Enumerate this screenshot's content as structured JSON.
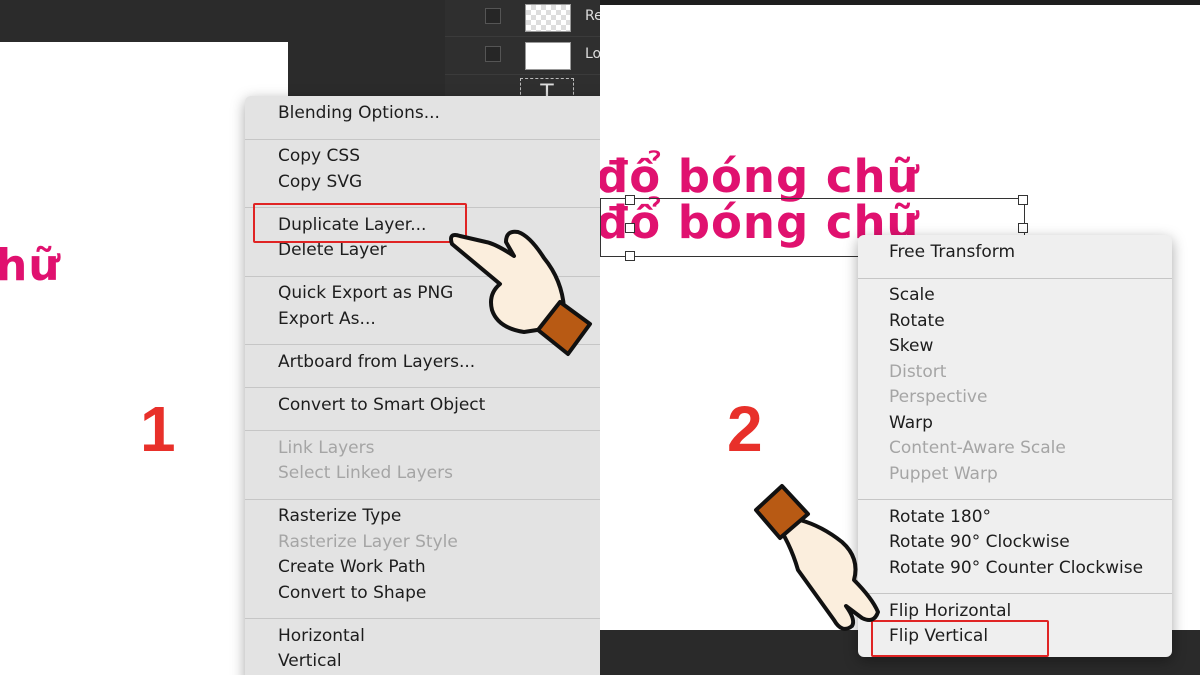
{
  "left": {
    "step_number": "1",
    "canvas_text": "hữ",
    "layers": [
      {
        "name": "Re",
        "thumb": "checker"
      },
      {
        "name": "Lo",
        "thumb": "white"
      }
    ],
    "text_layer_icon": "T",
    "context_menu": {
      "groups": [
        [
          {
            "label": "Blending Options...",
            "enabled": true
          }
        ],
        [
          {
            "label": "Copy CSS",
            "enabled": true
          },
          {
            "label": "Copy SVG",
            "enabled": true
          }
        ],
        [
          {
            "label": "Duplicate Layer...",
            "enabled": true,
            "highlighted": true
          },
          {
            "label": "Delete Layer",
            "enabled": true
          }
        ],
        [
          {
            "label": "Quick Export as PNG",
            "enabled": true
          },
          {
            "label": "Export As...",
            "enabled": true
          }
        ],
        [
          {
            "label": "Artboard from Layers...",
            "enabled": true
          }
        ],
        [
          {
            "label": "Convert to Smart Object",
            "enabled": true
          }
        ],
        [
          {
            "label": "Link Layers",
            "enabled": false
          },
          {
            "label": "Select Linked Layers",
            "enabled": false
          }
        ],
        [
          {
            "label": "Rasterize Type",
            "enabled": true
          },
          {
            "label": "Rasterize Layer Style",
            "enabled": false
          },
          {
            "label": "Create Work Path",
            "enabled": true
          },
          {
            "label": "Convert to Shape",
            "enabled": true
          }
        ],
        [
          {
            "label": "Horizontal",
            "enabled": true
          },
          {
            "label": "Vertical",
            "enabled": true
          }
        ]
      ]
    }
  },
  "right": {
    "step_number": "2",
    "canvas_lines": [
      "đổ bóng chữ",
      "đổ bóng chữ"
    ],
    "context_menu": {
      "groups": [
        [
          {
            "label": "Free Transform",
            "enabled": true
          }
        ],
        [
          {
            "label": "Scale",
            "enabled": true
          },
          {
            "label": "Rotate",
            "enabled": true
          },
          {
            "label": "Skew",
            "enabled": true
          },
          {
            "label": "Distort",
            "enabled": false
          },
          {
            "label": "Perspective",
            "enabled": false
          },
          {
            "label": "Warp",
            "enabled": true
          },
          {
            "label": "Content-Aware Scale",
            "enabled": false
          },
          {
            "label": "Puppet Warp",
            "enabled": false
          }
        ],
        [
          {
            "label": "Rotate 180°",
            "enabled": true
          },
          {
            "label": "Rotate 90° Clockwise",
            "enabled": true
          },
          {
            "label": "Rotate 90° Counter Clockwise",
            "enabled": true
          }
        ],
        [
          {
            "label": "Flip Horizontal",
            "enabled": true
          },
          {
            "label": "Flip Vertical",
            "enabled": true,
            "highlighted": true
          }
        ]
      ]
    }
  },
  "colors": {
    "accent_pink": "#e0116f",
    "highlight_red": "#e02424",
    "step_red": "#e8302a",
    "hand_cuff": "#b85a14"
  },
  "icons": {
    "pointer_hand_left": "pointing-hand-icon",
    "pointer_hand_right": "pointing-hand-icon"
  }
}
